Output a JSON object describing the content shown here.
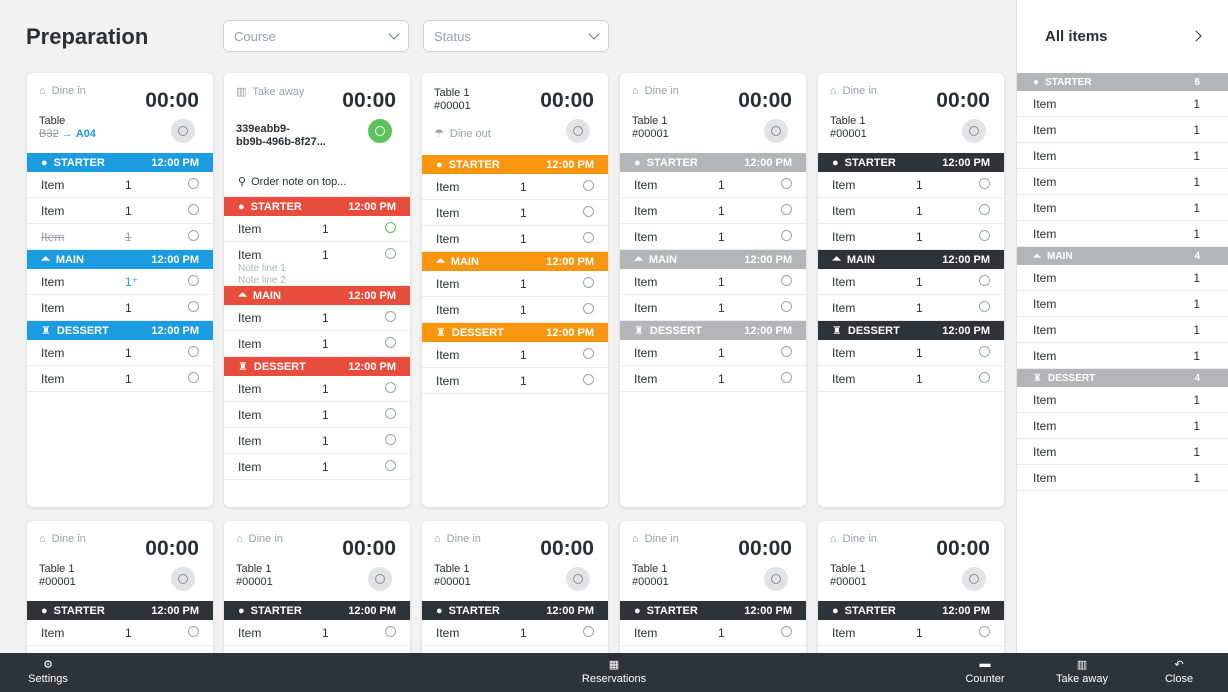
{
  "page": {
    "title": "Preparation"
  },
  "filters": {
    "course_placeholder": "Course",
    "status_placeholder": "Status"
  },
  "cards_row1": [
    {
      "top_label": "Dine in",
      "time": "00:00",
      "table_label": "Table",
      "move_from": "B32",
      "move_to": "A04",
      "sections": [
        {
          "name": "STARTER",
          "time": "12:00 PM",
          "color": "blue",
          "items": [
            {
              "name": "Item",
              "qty": "1"
            },
            {
              "name": "Item",
              "qty": "1"
            },
            {
              "name": "Item",
              "qty": "1",
              "struck": true
            }
          ]
        },
        {
          "name": "MAIN",
          "time": "12:00 PM",
          "color": "blue",
          "items": [
            {
              "name": "Item",
              "qty": "1⁺"
            },
            {
              "name": "Item",
              "qty": "1"
            }
          ]
        },
        {
          "name": "DESSERT",
          "time": "12:00 PM",
          "color": "blue",
          "items": [
            {
              "name": "Item",
              "qty": "1"
            },
            {
              "name": "Item",
              "qty": "1"
            }
          ]
        }
      ]
    },
    {
      "top_label": "Take away",
      "time": "00:00",
      "order_id_line1": "339eabb9-",
      "order_id_line2": "bb9b-496b-8f27...",
      "order_note": "Order note on top...",
      "sections": [
        {
          "name": "STARTER",
          "time": "12:00 PM",
          "color": "red",
          "items": [
            {
              "name": "Item",
              "qty": "1",
              "done": true
            },
            {
              "name": "Item",
              "qty": "1",
              "notes": [
                "Note line 1",
                "Note line 2"
              ]
            }
          ]
        },
        {
          "name": "MAIN",
          "time": "12:00 PM",
          "color": "red",
          "items": [
            {
              "name": "Item",
              "qty": "1"
            },
            {
              "name": "Item",
              "qty": "1"
            }
          ]
        },
        {
          "name": "DESSERT",
          "time": "12:00 PM",
          "color": "red",
          "items": [
            {
              "name": "Item",
              "qty": "1"
            },
            {
              "name": "Item",
              "qty": "1"
            },
            {
              "name": "Item",
              "qty": "1"
            },
            {
              "name": "Item",
              "qty": "1"
            }
          ]
        }
      ]
    },
    {
      "table": "Table 1",
      "order_no": "#00001",
      "time": "00:00",
      "sub_label": "Dine out",
      "sections": [
        {
          "name": "STARTER",
          "time": "12:00 PM",
          "color": "orange",
          "items": [
            {
              "name": "Item",
              "qty": "1"
            },
            {
              "name": "Item",
              "qty": "1"
            },
            {
              "name": "Item",
              "qty": "1"
            }
          ]
        },
        {
          "name": "MAIN",
          "time": "12:00 PM",
          "color": "orange",
          "items": [
            {
              "name": "Item",
              "qty": "1"
            },
            {
              "name": "Item",
              "qty": "1"
            }
          ]
        },
        {
          "name": "DESSERT",
          "time": "12:00 PM",
          "color": "orange",
          "items": [
            {
              "name": "Item",
              "qty": "1"
            },
            {
              "name": "Item",
              "qty": "1"
            }
          ]
        }
      ]
    },
    {
      "top_label": "Dine in",
      "table": "Table 1",
      "order_no": "#00001",
      "time": "00:00",
      "sections": [
        {
          "name": "STARTER",
          "time": "12:00 PM",
          "color": "grey",
          "items": [
            {
              "name": "Item",
              "qty": "1"
            },
            {
              "name": "Item",
              "qty": "1"
            },
            {
              "name": "Item",
              "qty": "1"
            }
          ]
        },
        {
          "name": "MAIN",
          "time": "12:00 PM",
          "color": "grey",
          "items": [
            {
              "name": "Item",
              "qty": "1"
            },
            {
              "name": "Item",
              "qty": "1"
            }
          ]
        },
        {
          "name": "DESSERT",
          "time": "12:00 PM",
          "color": "grey",
          "items": [
            {
              "name": "Item",
              "qty": "1"
            },
            {
              "name": "Item",
              "qty": "1"
            }
          ]
        }
      ]
    },
    {
      "top_label": "Dine in",
      "table": "Table 1",
      "order_no": "#00001",
      "time": "00:00",
      "sections": [
        {
          "name": "STARTER",
          "time": "12:00 PM",
          "color": "dark",
          "items": [
            {
              "name": "Item",
              "qty": "1"
            },
            {
              "name": "Item",
              "qty": "1"
            },
            {
              "name": "Item",
              "qty": "1"
            }
          ]
        },
        {
          "name": "MAIN",
          "time": "12:00 PM",
          "color": "dark",
          "items": [
            {
              "name": "Item",
              "qty": "1"
            },
            {
              "name": "Item",
              "qty": "1"
            }
          ]
        },
        {
          "name": "DESSERT",
          "time": "12:00 PM",
          "color": "dark",
          "items": [
            {
              "name": "Item",
              "qty": "1"
            },
            {
              "name": "Item",
              "qty": "1"
            }
          ]
        }
      ]
    }
  ],
  "cards_row2": [
    {
      "top_label": "Dine in",
      "table": "Table 1",
      "order_no": "#00001",
      "time": "00:00",
      "section": "STARTER",
      "section_time": "12:00 PM",
      "item": "Item",
      "qty": "1"
    },
    {
      "top_label": "Dine in",
      "table": "Table 1",
      "order_no": "#00001",
      "time": "00:00",
      "section": "STARTER",
      "section_time": "12:00 PM",
      "item": "Item",
      "qty": "1"
    },
    {
      "top_label": "Dine in",
      "table": "Table 1",
      "order_no": "#00001",
      "time": "00:00",
      "section": "STARTER",
      "section_time": "12:00 PM",
      "item": "Item",
      "qty": "1"
    },
    {
      "top_label": "Dine in",
      "table": "Table 1",
      "order_no": "#00001",
      "time": "00:00",
      "section": "STARTER",
      "section_time": "12:00 PM",
      "item": "Item",
      "qty": "1"
    },
    {
      "top_label": "Dine in",
      "table": "Table 1",
      "order_no": "#00001",
      "time": "00:00",
      "section": "STARTER",
      "section_time": "12:00 PM",
      "item": "Item",
      "qty": "1"
    }
  ],
  "sidebar": {
    "title": "All items",
    "sections": [
      {
        "name": "STARTER",
        "count": "6",
        "items": [
          {
            "name": "Item",
            "qty": "1"
          },
          {
            "name": "Item",
            "qty": "1"
          },
          {
            "name": "Item",
            "qty": "1"
          },
          {
            "name": "Item",
            "qty": "1"
          },
          {
            "name": "Item",
            "qty": "1"
          },
          {
            "name": "Item",
            "qty": "1"
          }
        ]
      },
      {
        "name": "MAIN",
        "count": "4",
        "items": [
          {
            "name": "Item",
            "qty": "1"
          },
          {
            "name": "Item",
            "qty": "1"
          },
          {
            "name": "Item",
            "qty": "1"
          },
          {
            "name": "Item",
            "qty": "1"
          }
        ]
      },
      {
        "name": "DESSERT",
        "count": "4",
        "items": [
          {
            "name": "Item",
            "qty": "1"
          },
          {
            "name": "Item",
            "qty": "1"
          },
          {
            "name": "Item",
            "qty": "1"
          },
          {
            "name": "Item",
            "qty": "1"
          }
        ]
      }
    ]
  },
  "bottom_bar": {
    "settings": "Settings",
    "reservations": "Reservations",
    "counter": "Counter",
    "take_away": "Take away",
    "close": "Close"
  },
  "colors": {
    "blue": "#1b9be0",
    "red": "#e84c3d",
    "orange": "#f8960f",
    "grey": "#b3b5b7",
    "dark": "#2e3338",
    "done_green": "#5cc35a"
  }
}
